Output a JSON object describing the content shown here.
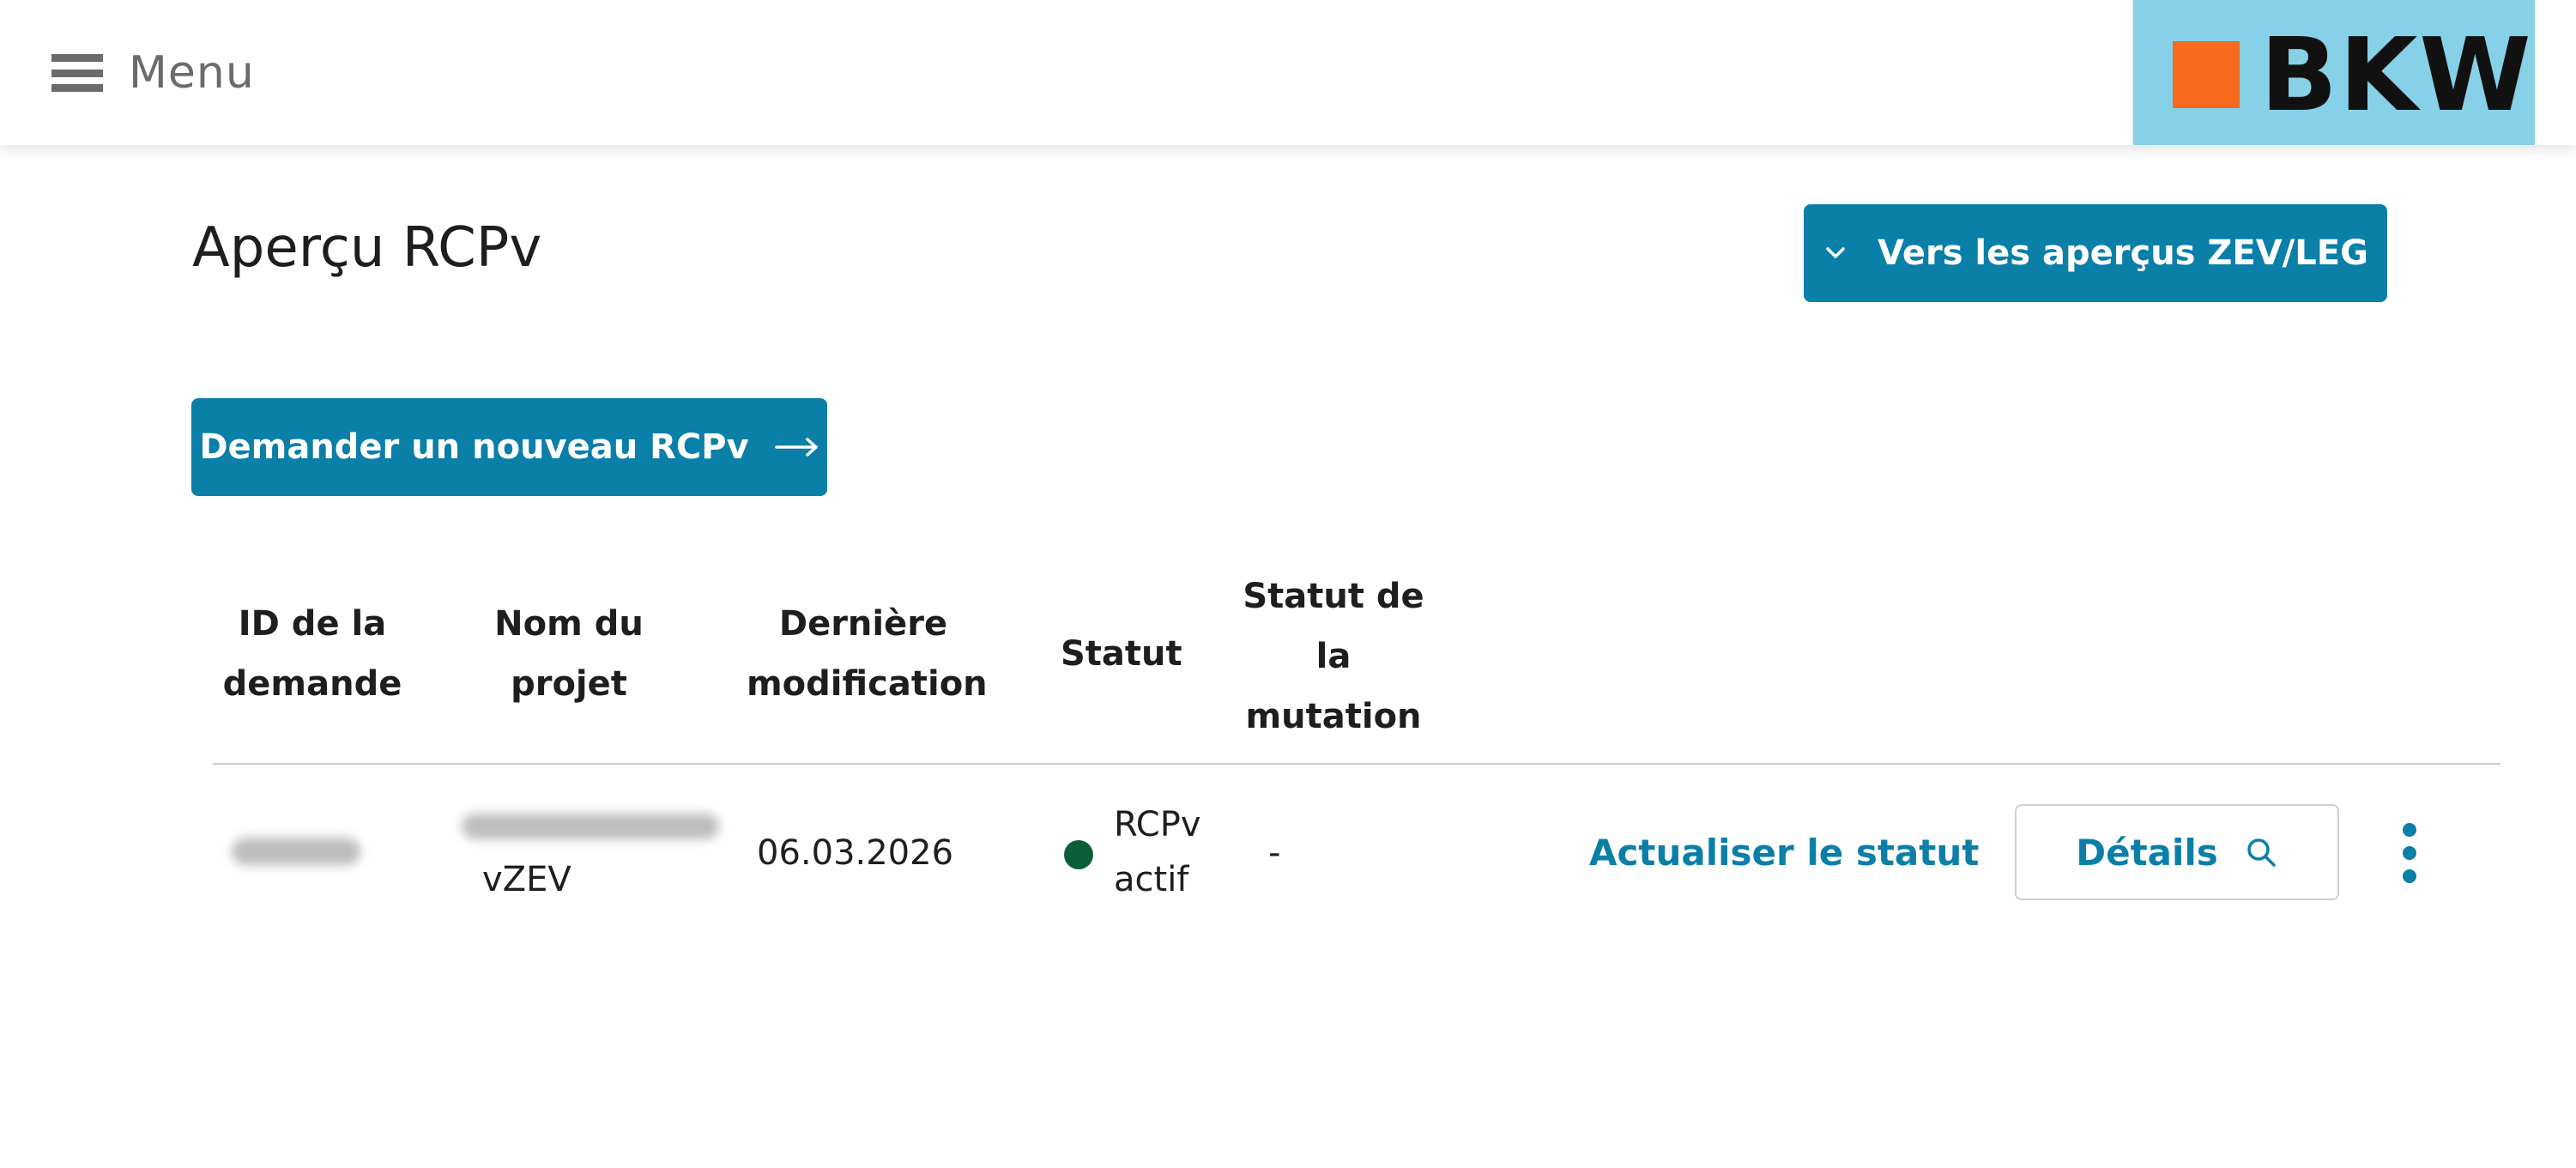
{
  "header": {
    "menu_label": "Menu",
    "logo_text": "BKW"
  },
  "page": {
    "title": "Aperçu RCPv",
    "overview_button": "Vers les aperçus ZEV/LEG",
    "request_button": "Demander un nouveau RCPv"
  },
  "table": {
    "columns": [
      "ID de la demande",
      "Nom du projet",
      "Dernière modification",
      "Statut",
      "Statut de la mutation"
    ],
    "rows": [
      {
        "name_suffix": "vZEV",
        "last_modified": "06.03.2026",
        "status": "RCPv actif",
        "mutation_status": "-",
        "refresh_label": "Actualiser le statut",
        "details_label": "Détails"
      }
    ]
  },
  "colors": {
    "primary": "#0a7fa8",
    "status_active": "#0b5e3a",
    "logo_bg": "#87d1e8",
    "logo_square": "#f56a1c"
  }
}
